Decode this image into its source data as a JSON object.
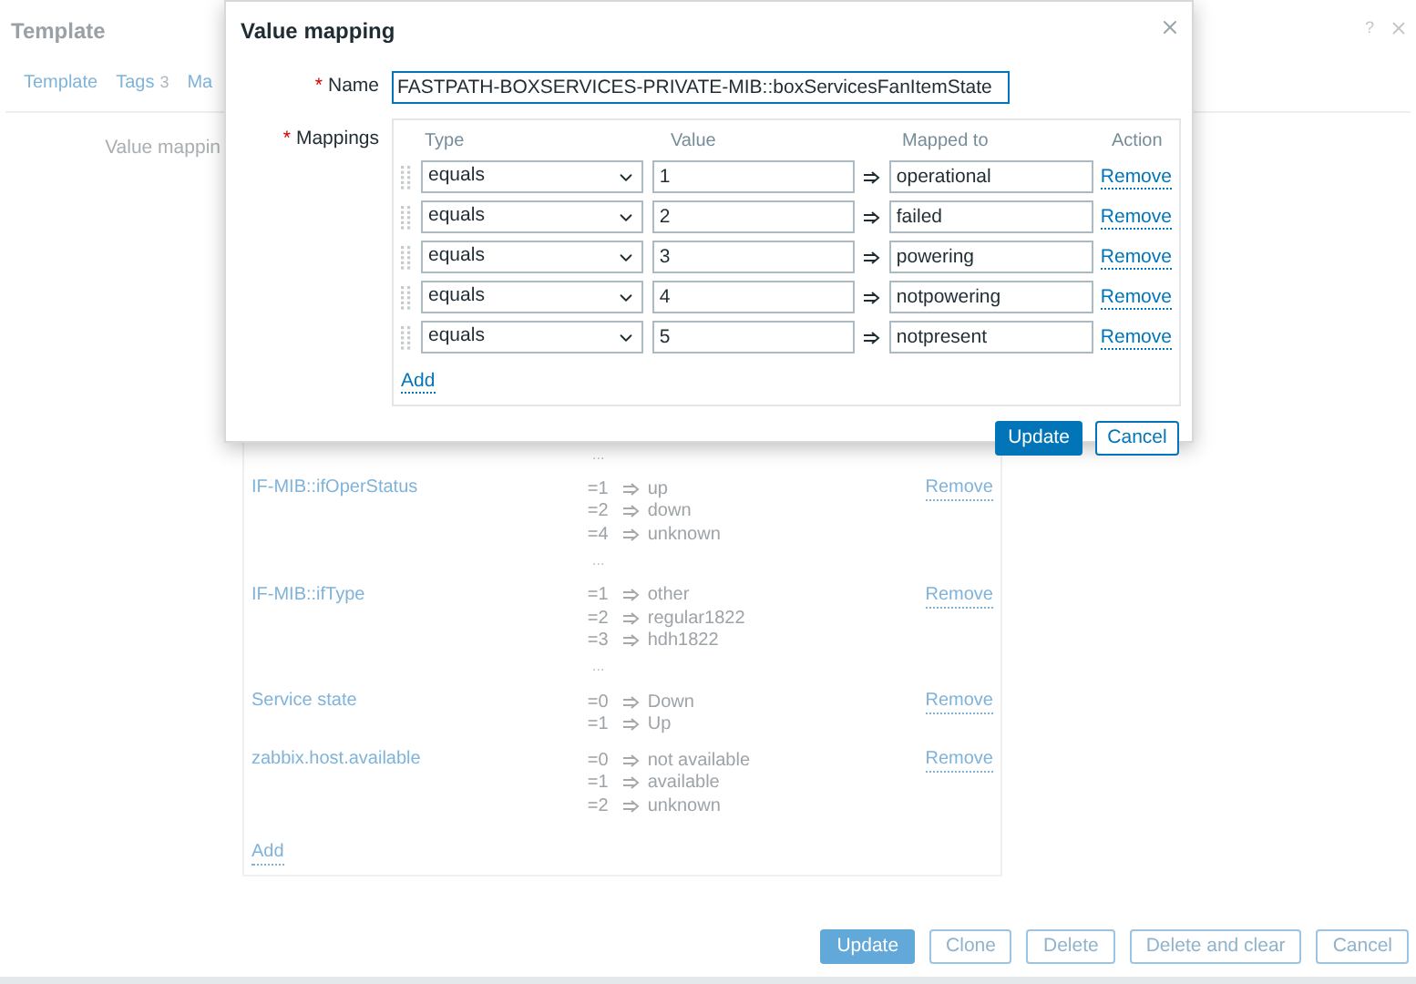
{
  "page": {
    "title": "Template",
    "help": "?"
  },
  "tabs": [
    {
      "label": "Template"
    },
    {
      "label": "Tags",
      "count": "3"
    },
    {
      "label": "Ma"
    }
  ],
  "form_label": "Value mappin",
  "leading_more": "...",
  "value_maps": [
    {
      "name": "IF-MIB::ifOperStatus",
      "mappings": [
        {
          "value": "=1",
          "mapped_to": "up"
        },
        {
          "value": "=2",
          "mapped_to": "down"
        },
        {
          "value": "=4",
          "mapped_to": "unknown"
        }
      ],
      "more": "...",
      "action": "Remove"
    },
    {
      "name": "IF-MIB::ifType",
      "mappings": [
        {
          "value": "=1",
          "mapped_to": "other"
        },
        {
          "value": "=2",
          "mapped_to": "regular1822"
        },
        {
          "value": "=3",
          "mapped_to": "hdh1822"
        }
      ],
      "more": "...",
      "action": "Remove"
    },
    {
      "name": "Service state",
      "mappings": [
        {
          "value": "=0",
          "mapped_to": "Down"
        },
        {
          "value": "=1",
          "mapped_to": "Up"
        }
      ],
      "action": "Remove"
    },
    {
      "name": "zabbix.host.available",
      "mappings": [
        {
          "value": "=0",
          "mapped_to": "not available"
        },
        {
          "value": "=1",
          "mapped_to": "available"
        },
        {
          "value": "=2",
          "mapped_to": "unknown"
        }
      ],
      "action": "Remove"
    }
  ],
  "list_add": "Add",
  "buttons": [
    {
      "label": "Update",
      "kind": "primary"
    },
    {
      "label": "Clone",
      "kind": "secondary"
    },
    {
      "label": "Delete",
      "kind": "secondary"
    },
    {
      "label": "Delete and clear",
      "kind": "secondary"
    },
    {
      "label": "Cancel",
      "kind": "secondary"
    }
  ],
  "dialog": {
    "title": "Value mapping",
    "name_label": {
      "text": "Name",
      "required_mark": "*"
    },
    "name_value": "FASTPATH-BOXSERVICES-PRIVATE-MIB::boxServicesFanItemState",
    "mappings_label": {
      "text": "Mappings",
      "required_mark": "*"
    },
    "columns": [
      "Type",
      "Value",
      "Mapped to",
      "Action"
    ],
    "rows": [
      {
        "type": "equals",
        "value": "1",
        "mapped_to": "operational",
        "action": "Remove"
      },
      {
        "type": "equals",
        "value": "2",
        "mapped_to": "failed",
        "action": "Remove"
      },
      {
        "type": "equals",
        "value": "3",
        "mapped_to": "powering",
        "action": "Remove"
      },
      {
        "type": "equals",
        "value": "4",
        "mapped_to": "notpowering",
        "action": "Remove"
      },
      {
        "type": "equals",
        "value": "5",
        "mapped_to": "notpresent",
        "action": "Remove"
      }
    ],
    "add": "Add",
    "buttons": [
      {
        "label": "Update",
        "kind": "primary"
      },
      {
        "label": "Cancel",
        "kind": "secondary"
      }
    ]
  }
}
